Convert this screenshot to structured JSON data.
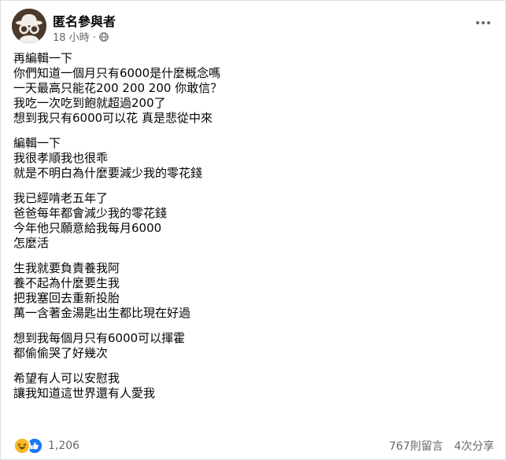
{
  "post": {
    "author": "匿名參與者",
    "time": "18 小時 ·",
    "paragraphs": [
      {
        "lines": [
          "再編輯一下",
          "你們知道一個月只有6000是什麼概念嗎",
          "一天最高只能花200 200 200 你敢信？",
          "我吃一次吃到飽就超過200了",
          "想到我只有6000可以花 真是悲從中來"
        ]
      },
      {
        "lines": [
          "編輯一下",
          "我很孝順我也很乖",
          "就是不明白為什麼要減少我的零花錢"
        ]
      },
      {
        "lines": [
          "我已經啃老五年了",
          "爸爸每年都會減少我的零花錢",
          "今年他只願意給我每月6000",
          "怎麼活"
        ]
      },
      {
        "lines": [
          "生我就要負責養我阿",
          "養不起為什麼要生我",
          "把我塞回去重新投胎",
          "萬一含著金湯匙出生都比現在好過"
        ]
      },
      {
        "lines": [
          "想到我每個月只有6000可以揮霍",
          "都偷偷哭了好幾次"
        ]
      },
      {
        "lines": [
          "希望有人可以安慰我",
          "讓我知道這世界還有人愛我"
        ]
      }
    ],
    "reaction_count": "1,206",
    "comments": "767則留言",
    "shares": "4次分享"
  },
  "icons": {
    "avatar": "anonymous-avatar-icon",
    "privacy": "globe-icon",
    "more": "more-options-icon",
    "reactions": [
      "haha-icon",
      "like-icon"
    ]
  },
  "colors": {
    "text": "#050505",
    "secondary": "#65676b",
    "like": "#1877f2",
    "haha": "#f7b928"
  }
}
